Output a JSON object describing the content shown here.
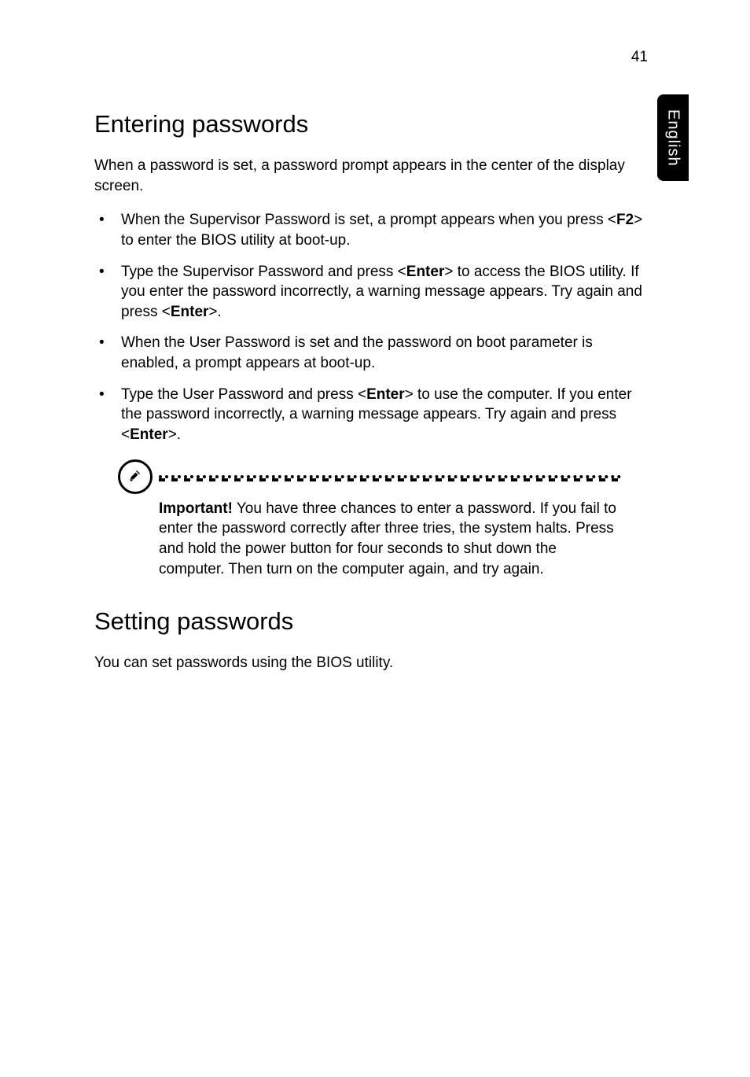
{
  "page_number": "41",
  "side_tab": "English",
  "section1": {
    "heading": "Entering passwords",
    "intro": "When a password is set, a password prompt appears in the center of the display screen.",
    "items": [
      {
        "pre": "When the Supervisor Password is set, a prompt appears when you press <",
        "key1": "F2",
        "post1": "> to enter the BIOS utility at boot-up."
      },
      {
        "pre": "Type the Supervisor Password and press <",
        "key1": "Enter",
        "mid": "> to access the BIOS utility. If you enter the password incorrectly, a warning message appears. Try again and press <",
        "key2": "Enter",
        "post2": ">."
      },
      {
        "text": "When the User Password is set and the password on boot parameter is enabled, a prompt appears at boot-up."
      },
      {
        "pre": "Type the User Password and press <",
        "key1": "Enter",
        "mid": "> to use the computer. If you enter the password incorrectly, a warning message appears. Try again and press <",
        "key2": "Enter",
        "post2": ">."
      }
    ],
    "note": {
      "label": "Important!",
      "text": " You have three chances to enter a password. If you fail to enter the password correctly after three tries, the system halts. Press and hold the power button for four seconds to shut down the computer. Then turn on the computer again, and try again."
    }
  },
  "section2": {
    "heading": "Setting passwords",
    "text": "You can set passwords using the BIOS utility."
  }
}
